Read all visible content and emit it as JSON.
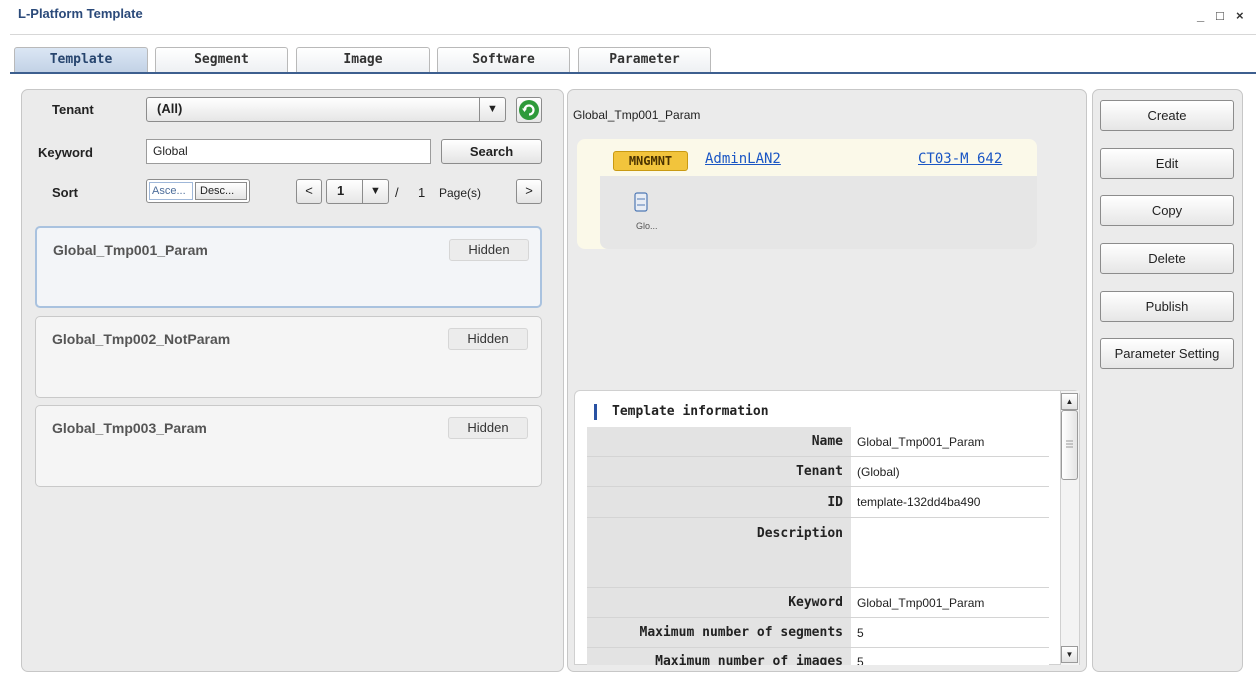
{
  "app": {
    "title": "L-Platform Template"
  },
  "window_controls": {
    "minimize": "_",
    "maximize": "□",
    "close": "×"
  },
  "tabs": [
    {
      "label": "Template",
      "active": true
    },
    {
      "label": "Segment"
    },
    {
      "label": "Image"
    },
    {
      "label": "Software"
    },
    {
      "label": "Parameter"
    }
  ],
  "filters": {
    "tenant_label": "Tenant",
    "tenant_value": "(All)",
    "keyword_label": "Keyword",
    "keyword_value": "Global",
    "search_label": "Search",
    "sort_label": "Sort",
    "sort_asc": "Asce...",
    "sort_desc": "Desc...",
    "page_current": "1",
    "page_sep": "/",
    "page_total": "1",
    "page_suffix": "Page(s)"
  },
  "templates": [
    {
      "name": "Global_Tmp001_Param",
      "status": "Hidden",
      "selected": true
    },
    {
      "name": "Global_Tmp002_NotParam",
      "status": "Hidden"
    },
    {
      "name": "Global_Tmp003_Param",
      "status": "Hidden"
    }
  ],
  "preview": {
    "title": "Global_Tmp001_Param",
    "segment_badge": "MNGMNT",
    "segment_name": "AdminLAN2",
    "segment_ref": "CT03-M 642",
    "server_label": "Glo..."
  },
  "info": {
    "heading": "Template information",
    "rows": [
      {
        "key": "Name",
        "value": "Global_Tmp001_Param"
      },
      {
        "key": "Tenant",
        "value": "(Global)"
      },
      {
        "key": "ID",
        "value": "template-132dd4ba490"
      },
      {
        "key": "Description",
        "value": ""
      },
      {
        "key": "Keyword",
        "value": "Global_Tmp001_Param"
      },
      {
        "key": "Maximum number of segments",
        "value": "5"
      },
      {
        "key": "Maximum number of images",
        "value": "5"
      }
    ]
  },
  "actions": [
    "Create",
    "Edit",
    "Copy",
    "Delete",
    "Publish",
    "Parameter Setting"
  ],
  "colors": {
    "accent": "#3d5f8f",
    "link": "#1a56c4",
    "badge": "#f2c43c",
    "refresh": "#2e9a3a"
  },
  "icons": {
    "refresh": "refresh-icon",
    "dropdown": "chevron-down-icon",
    "prev": "chevron-left-icon",
    "next": "chevron-right-icon",
    "server": "server-icon",
    "scroll_up": "arrow-up-icon",
    "scroll_down": "arrow-down-icon"
  }
}
